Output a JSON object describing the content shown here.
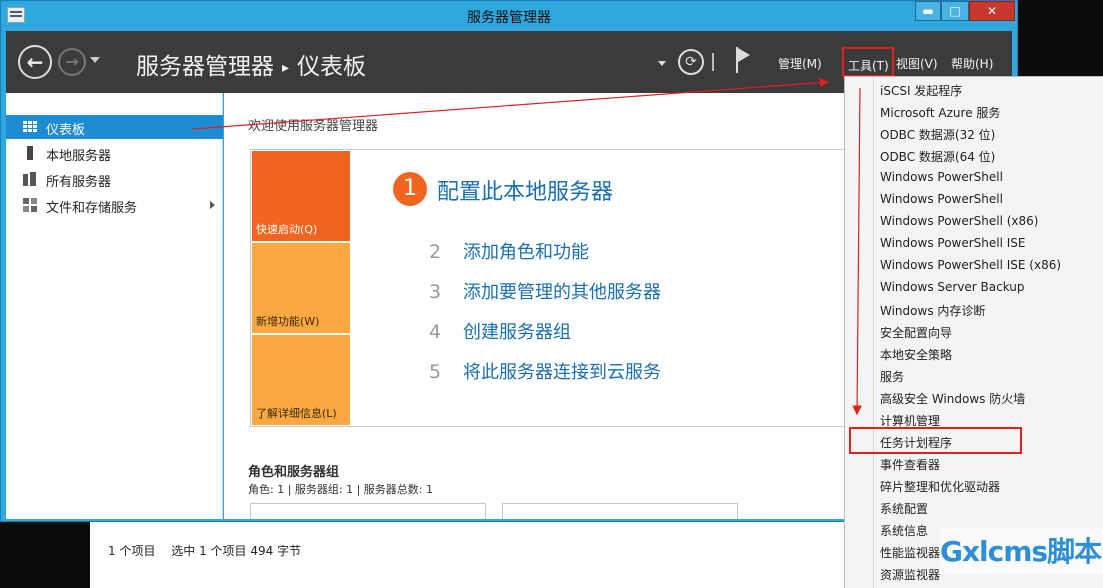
{
  "window": {
    "title": "服务器管理器",
    "minimize": "▬",
    "maximize": "□",
    "close": "✕"
  },
  "header": {
    "breadcrumb_root": "服务器管理器",
    "breadcrumb_sep": "▸",
    "breadcrumb_current": "仪表板",
    "menus": [
      "管理(M)",
      "工具(T)",
      "视图(V)",
      "帮助(H)"
    ]
  },
  "sidebar": {
    "items": [
      {
        "label": "仪表板",
        "icon": "dashboard-icon",
        "selected": true
      },
      {
        "label": "本地服务器",
        "icon": "server-icon"
      },
      {
        "label": "所有服务器",
        "icon": "servers-icon"
      },
      {
        "label": "文件和存储服务",
        "icon": "file-storage-icon"
      }
    ]
  },
  "main": {
    "welcome_title": "欢迎使用服务器管理器",
    "tiles": [
      "快速启动(Q)",
      "新增功能(W)",
      "了解详细信息(L)"
    ],
    "steps": [
      {
        "num": "1",
        "text": "配置此本地服务器"
      },
      {
        "num": "2",
        "text": "添加角色和功能"
      },
      {
        "num": "3",
        "text": "添加要管理的其他服务器"
      },
      {
        "num": "4",
        "text": "创建服务器组"
      },
      {
        "num": "5",
        "text": "将此服务器连接到云服务"
      }
    ],
    "roles_title": "角色和服务器组",
    "roles_summary": "角色: 1 | 服务器组: 1 | 服务器总数: 1"
  },
  "tools_menu": {
    "items": [
      "iSCSI 发起程序",
      "Microsoft Azure 服务",
      "ODBC 数据源(32 位)",
      "ODBC 数据源(64 位)",
      "Windows PowerShell",
      "Windows PowerShell",
      "Windows PowerShell (x86)",
      "Windows PowerShell ISE",
      "Windows PowerShell ISE (x86)",
      "Windows Server Backup",
      "Windows 内存诊断",
      "安全配置向导",
      "本地安全策略",
      "服务",
      "高级安全 Windows 防火墙",
      "计算机管理",
      "任务计划程序",
      "事件查看器",
      "碎片整理和优化驱动器",
      "系统配置",
      "系统信息",
      "性能监视器",
      "资源监视器"
    ],
    "highlighted": "任务计划程序"
  },
  "explorer_status": {
    "items": "1 个项目",
    "selected": "选中 1 个项目  494 字节"
  },
  "watermark": {
    "text": "Gxlcms脚本"
  },
  "colors": {
    "title_bar": "#2fa8e0",
    "header": "#3b3b3b",
    "accent_selected": "#1e8bd2",
    "tile_orange": "#f26521",
    "tile_light_orange": "#faa83f",
    "annotation_red": "#e0201a"
  }
}
